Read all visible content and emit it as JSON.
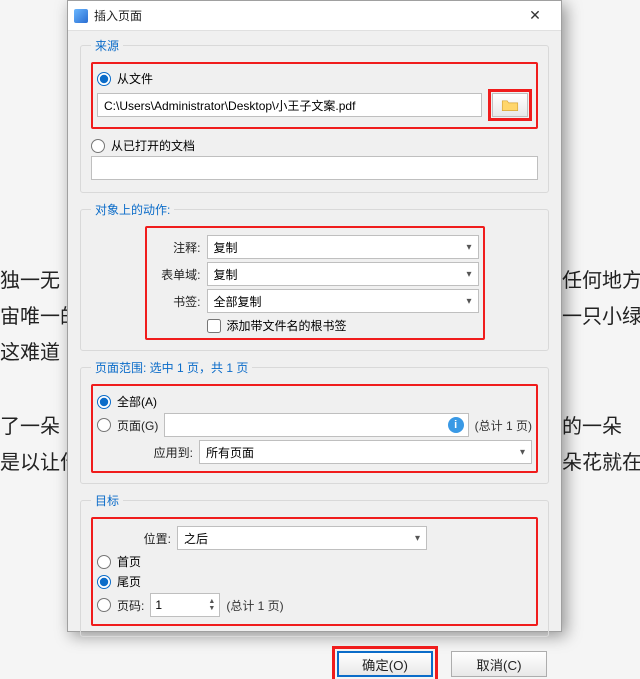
{
  "window": {
    "title": "插入页面"
  },
  "source": {
    "legend": "来源",
    "from_file_label": "从文件",
    "file_path": "C:\\Users\\Administrator\\Desktop\\小王子文案.pdf",
    "from_open_label": "从已打开的文档",
    "open_doc_value": ""
  },
  "actions": {
    "legend": "对象上的动作:",
    "annot_label": "注释:",
    "annot_value": "复制",
    "form_label": "表单域:",
    "form_value": "复制",
    "bookmark_label": "书签:",
    "bookmark_value": "全部复制",
    "add_root_bookmark_label": "添加带文件名的根书签"
  },
  "range": {
    "legend": "页面范围: 选中 1 页，共 1 页",
    "all_label": "全部(A)",
    "pages_label": "页面(G)",
    "total_label_1": "(总计 1 页)",
    "apply_to_label": "应用到:",
    "apply_to_value": "所有页面"
  },
  "dest": {
    "legend": "目标",
    "position_label": "位置:",
    "position_value": "之后",
    "first_label": "首页",
    "last_label": "尾页",
    "page_label": "页码:",
    "page_value": "1",
    "total_label_2": "(总计 1 页)"
  },
  "buttons": {
    "ok": "确定(O)",
    "cancel": "取消(C)"
  },
  "bg": {
    "l1": "独一无",
    "l2": "宙唯一的",
    "l3": "这难道",
    "l4": "了一朵",
    "l5": "是以让作",
    "r1": "任何地方",
    "r2": "一只小绿",
    "r3": "的一朵",
    "r4": "朵花就在基"
  }
}
